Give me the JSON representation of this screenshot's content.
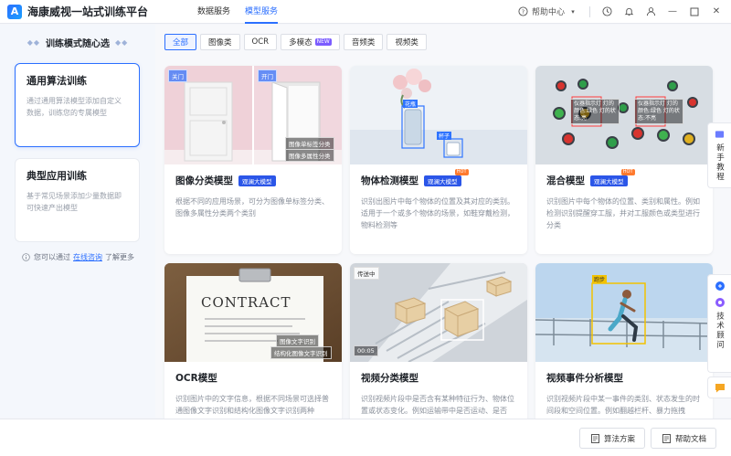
{
  "app": {
    "title": "海康威视一站式训练平台"
  },
  "nav": {
    "items": [
      "数据服务",
      "模型服务"
    ],
    "active_index": 1
  },
  "header": {
    "help_center": "帮助中心"
  },
  "sidebar": {
    "title": "训练模式随心选",
    "cards": [
      {
        "title": "通用算法训练",
        "desc": "通过通用算法模型添加自定义数据，训练您的专属模型",
        "selected": true
      },
      {
        "title": "典型应用训练",
        "desc": "基于常见场景添加少量数据即可快速产出模型",
        "selected": false
      }
    ],
    "note_prefix": "您可以通过",
    "note_link": "在线咨询",
    "note_suffix": "了解更多"
  },
  "tabs": [
    {
      "label": "全部",
      "active": true
    },
    {
      "label": "图像类",
      "active": false
    },
    {
      "label": "OCR",
      "active": false
    },
    {
      "label": "多模态",
      "badge": "NEW",
      "active": false
    },
    {
      "label": "音频类",
      "active": false
    },
    {
      "label": "视频类",
      "active": false
    }
  ],
  "cards": [
    {
      "title": "图像分类模型",
      "badge": "观澜大模型",
      "hot": "",
      "desc": "根据不同的应用场景，可分为图像单标签分类、图像多属性分类两个类别",
      "labels": [
        "关门",
        "开门",
        "图像单标签分类",
        "图像多属性分类"
      ]
    },
    {
      "title": "物体检测模型",
      "badge": "观澜大模型",
      "hot": "HOT",
      "desc": "识别出图片中每个物体的位置及其对应的类别。适用于一个或多个物体的场景，如鞋穿戴检测，物料检测等",
      "labels": [
        "花瓶",
        "杯子"
      ]
    },
    {
      "title": "混合模型",
      "badge": "观澜大模型",
      "hot": "HOT",
      "desc": "识别图片中每个物体的位置、类别和属性。例如检测识别提醒穿工服，并对工服颜色或类型进行分类",
      "labels": [
        "仪器指示灯 灯的颜色:绿色 灯的状态:亮",
        "仪器指示灯 灯的颜色:绿色 灯的状态:不亮"
      ]
    },
    {
      "title": "OCR模型",
      "badge": "",
      "hot": "",
      "desc": "识别图片中的文字信息，根据不同场景可选择普通图像文字识别和结构化图像文字识别两种",
      "labels": [
        "CONTRACT",
        "图像文字识别",
        "结构化图像文字识别"
      ]
    },
    {
      "title": "视频分类模型",
      "badge": "",
      "hot": "",
      "desc": "识别视频片段中是否含有某种特征行为、物体位置或状态变化。例如运输带中是否运动、是否",
      "labels": [
        "传送中",
        "00:05"
      ]
    },
    {
      "title": "视频事件分析模型",
      "badge": "",
      "hot": "",
      "desc": "识别视频片段中某一事件的类别、状态发生的时间段和空间位置。例如翻越栏杆、暴力拖拽",
      "labels": [
        "跑步"
      ]
    }
  ],
  "float": {
    "tutorial": "新手教程",
    "consult": "技术顾问"
  },
  "footer": {
    "plan": "算法方案",
    "docs": "帮助文档"
  }
}
